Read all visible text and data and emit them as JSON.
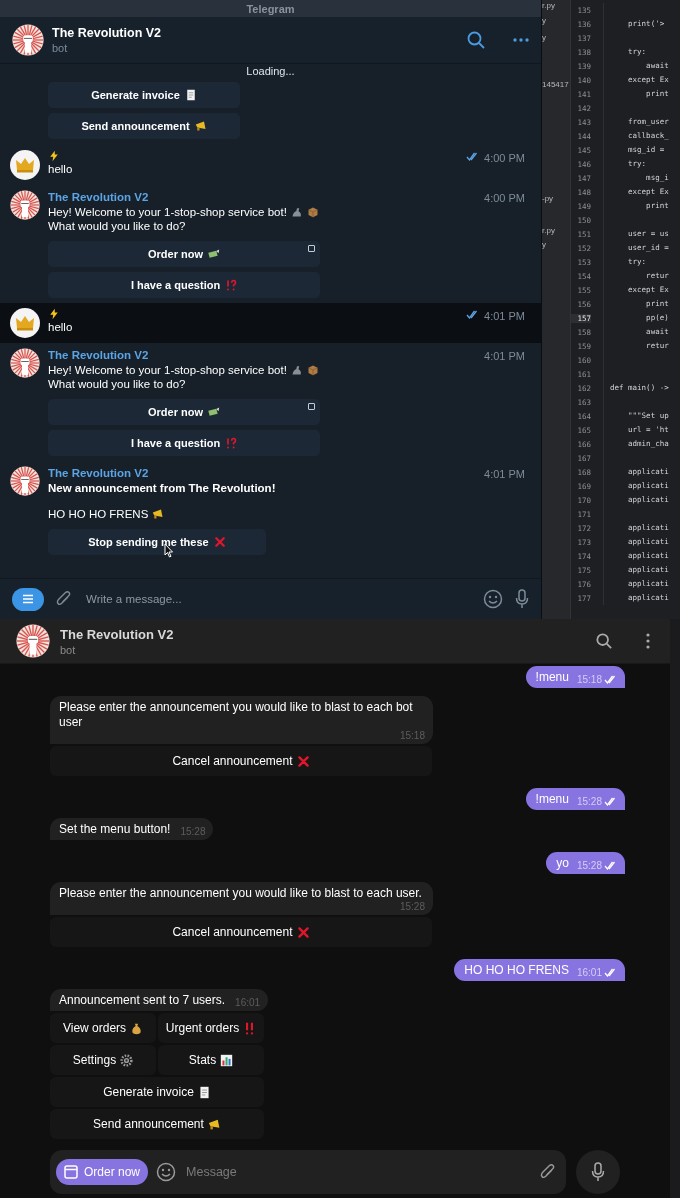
{
  "desktop_title": "Telegram",
  "top_chat": {
    "title": "The Revolution V2",
    "subtitle": "bot",
    "loading": "Loading...",
    "keyboard": [
      {
        "label": "Generate invoice",
        "kind": "receipt"
      },
      {
        "label": "Send announcement",
        "kind": "megaphone"
      }
    ],
    "messages": [
      {
        "kind": "user",
        "text": "hello",
        "time": "4:00 PM",
        "read": true,
        "highlighted": false
      },
      {
        "kind": "bot",
        "sender": "The Revolution V2",
        "time": "4:00 PM",
        "paragraphs": [
          [
            {
              "text": "Hey! Welcome to your 1-stop-shop service bot!",
              "kind": "welcome",
              "bold": false
            },
            {
              "text": "What would you like to do?",
              "kind": "plain",
              "bold": false
            }
          ]
        ],
        "buttons": [
          {
            "label": "Order now",
            "kind": "banknote",
            "webapp": true,
            "hovered": false
          },
          {
            "label": "I have a question",
            "kind": "interrobang",
            "webapp": false,
            "hovered": false
          }
        ]
      },
      {
        "kind": "user",
        "text": "hello",
        "time": "4:01 PM",
        "read": true,
        "highlighted": true
      },
      {
        "kind": "bot",
        "sender": "The Revolution V2",
        "time": "4:01 PM",
        "paragraphs": [
          [
            {
              "text": "Hey! Welcome to your 1-stop-shop service bot!",
              "kind": "welcome",
              "bold": false
            },
            {
              "text": "What would you like to do?",
              "kind": "plain",
              "bold": false
            }
          ]
        ],
        "buttons": [
          {
            "label": "Order now",
            "kind": "banknote",
            "webapp": true,
            "hovered": false
          },
          {
            "label": "I have a question",
            "kind": "interrobang",
            "webapp": false,
            "hovered": false
          }
        ]
      },
      {
        "kind": "bot",
        "sender": "The Revolution V2",
        "time": "4:01 PM",
        "paragraphs": [
          [
            {
              "text": "New announcement from The Revolution!",
              "kind": "plain",
              "bold": true
            }
          ],
          [
            {
              "text": "HO HO HO FRENS",
              "kind": "announcement",
              "bold": false
            }
          ]
        ],
        "buttons": [
          {
            "label": "Stop sending me these",
            "kind": "cross",
            "webapp": false,
            "hovered": true
          }
        ]
      }
    ],
    "composer": {
      "placeholder": "Write a message..."
    }
  },
  "editor": {
    "files": [
      "r.py",
      "y",
      "y",
      "145417",
      "-py",
      "r.py",
      "y"
    ],
    "lines": [
      {
        "number": "135",
        "selected": false
      },
      {
        "number": "136",
        "code": "    print('>",
        "selected": false
      },
      {
        "number": "137",
        "selected": false
      },
      {
        "number": "138",
        "code": "    try:",
        "selected": false
      },
      {
        "number": "139",
        "code": "        await",
        "selected": false
      },
      {
        "number": "140",
        "code": "    except Ex",
        "selected": false
      },
      {
        "number": "141",
        "code": "        print",
        "selected": false
      },
      {
        "number": "142",
        "selected": false
      },
      {
        "number": "143",
        "code": "    from_user",
        "selected": false
      },
      {
        "number": "144",
        "code": "    callback_",
        "selected": false
      },
      {
        "number": "145",
        "code": "    msg_id =",
        "selected": false
      },
      {
        "number": "146",
        "code": "    try:",
        "selected": false
      },
      {
        "number": "147",
        "code": "        msg_i",
        "selected": false
      },
      {
        "number": "148",
        "code": "    except Ex",
        "selected": false
      },
      {
        "number": "149",
        "code": "        print",
        "selected": false
      },
      {
        "number": "150",
        "selected": false
      },
      {
        "number": "151",
        "code": "    user = us",
        "selected": false
      },
      {
        "number": "152",
        "code": "    user_id =",
        "selected": false
      },
      {
        "number": "153",
        "code": "    try:",
        "selected": false
      },
      {
        "number": "154",
        "code": "        retur",
        "selected": false
      },
      {
        "number": "155",
        "code": "    except Ex",
        "selected": false
      },
      {
        "number": "156",
        "code": "        print",
        "selected": false
      },
      {
        "number": "157",
        "code": "        pp(e)",
        "selected": true
      },
      {
        "number": "158",
        "code": "        await",
        "selected": false
      },
      {
        "number": "159",
        "code": "        retur",
        "selected": false
      },
      {
        "number": "160",
        "selected": false
      },
      {
        "number": "161",
        "selected": false
      },
      {
        "number": "162",
        "code": "def main() ->",
        "selected": false
      },
      {
        "number": "163",
        "selected": false
      },
      {
        "number": "164",
        "code": "    \"\"\"Set up",
        "selected": false
      },
      {
        "number": "165",
        "code": "    url = 'ht",
        "selected": false
      },
      {
        "number": "166",
        "code": "    admin_cha",
        "selected": false
      },
      {
        "number": "167",
        "selected": false
      },
      {
        "number": "168",
        "code": "    applicati",
        "selected": false
      },
      {
        "number": "169",
        "code": "    applicati",
        "selected": false
      },
      {
        "number": "170",
        "code": "    applicati",
        "selected": false
      },
      {
        "number": "171",
        "selected": false
      },
      {
        "number": "172",
        "code": "    applicati",
        "selected": false
      },
      {
        "number": "173",
        "code": "    applicati",
        "selected": false
      },
      {
        "number": "174",
        "code": "    applicati",
        "selected": false
      },
      {
        "number": "175",
        "code": "    applicati",
        "selected": false
      },
      {
        "number": "176",
        "code": "    applicati",
        "selected": false
      },
      {
        "number": "177",
        "code": "    applicati",
        "selected": false
      }
    ]
  },
  "bottom_chat": {
    "title": "The Revolution V2",
    "subtitle": "bot",
    "messages": [
      {
        "kind": "out",
        "text": "!menu",
        "time": "15:18",
        "read": true
      },
      {
        "kind": "in",
        "text": "Please enter the announcement you would like to blast to each bot user",
        "time": "15:18",
        "keyboard": [
          [
            {
              "label": "Cancel announcement",
              "kind": "cross"
            }
          ]
        ]
      },
      {
        "kind": "out",
        "text": "!menu",
        "time": "15:28",
        "read": true
      },
      {
        "kind": "in",
        "text": "Set the menu button!",
        "time": "15:28"
      },
      {
        "kind": "out",
        "text": "yo",
        "time": "15:28",
        "read": true
      },
      {
        "kind": "in",
        "text": "Please enter the announcement you would like to blast to each user.",
        "time": "15:28",
        "keyboard": [
          [
            {
              "label": "Cancel announcement",
              "kind": "cross"
            }
          ]
        ]
      },
      {
        "kind": "out",
        "text": "HO HO HO FRENS",
        "time": "16:01",
        "read": true
      },
      {
        "kind": "in",
        "text": "Announcement sent to 7 users.",
        "time": "16:01",
        "keyboard": [
          [
            {
              "label": "View orders",
              "kind": "money-bag"
            },
            {
              "label": "Urgent orders",
              "kind": "double-exclamation"
            }
          ],
          [
            {
              "label": "Settings",
              "kind": "gear"
            },
            {
              "label": "Stats",
              "kind": "chart"
            }
          ],
          [
            {
              "label": "Generate invoice",
              "kind": "receipt"
            }
          ],
          [
            {
              "label": "Send announcement",
              "kind": "megaphone"
            }
          ]
        ]
      }
    ],
    "composer": {
      "menu_button": "Order now",
      "placeholder": "Message"
    }
  }
}
